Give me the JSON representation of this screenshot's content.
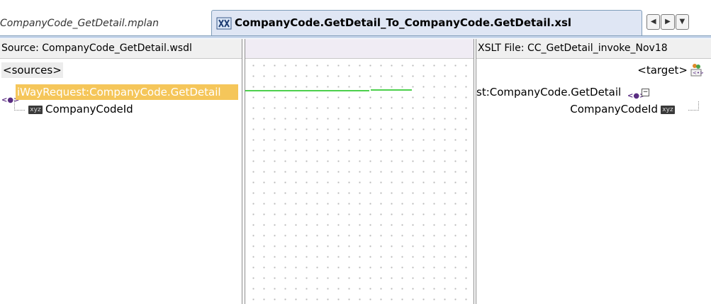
{
  "tabs": {
    "mplan_tab": "CompanyCode_GetDetail.mplan",
    "xsl_tab": "CompanyCode.GetDetail_To_CompanyCode.GetDetail.xsl"
  },
  "nav": {
    "left": "◀",
    "right": "▶",
    "menu": "▼"
  },
  "source_panel": {
    "header": "Source: CompanyCode_GetDetail.wsdl",
    "root_label": "<sources>",
    "request_node": "iWayRequest:CompanyCode.GetDetail",
    "child_node": "CompanyCodeId",
    "attr_icon_text": "xyz"
  },
  "target_panel": {
    "header": "XSLT File: CC_GetDetail_invoke_Nov18",
    "root_label": "<target>",
    "request_node": "st:CompanyCode.GetDetail",
    "child_node": "CompanyCodeId",
    "attr_icon_text": "xyz"
  },
  "colors": {
    "selection": "#f5c65a",
    "map_line": "#4cd04c",
    "active_tab": "#dfe6f4"
  },
  "icons": [
    "xsl-file-icon",
    "element-icon",
    "attribute-icon",
    "target-node-icon",
    "collapse-icon"
  ]
}
